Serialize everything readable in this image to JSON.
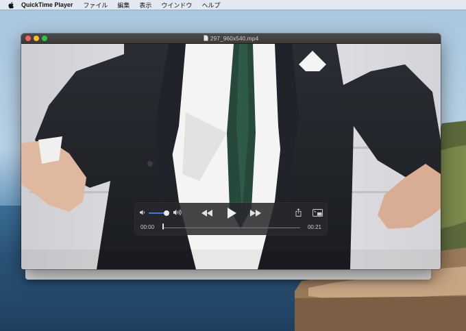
{
  "menubar": {
    "app_name": "QuickTime Player",
    "items": [
      "ファイル",
      "編集",
      "表示",
      "ウインドウ",
      "ヘルプ"
    ]
  },
  "window": {
    "title": "297_960x540.mp4"
  },
  "player": {
    "current_time": "00:00",
    "total_time": "00:21",
    "volume_level": 0.85,
    "progress": 0.0
  },
  "colors": {
    "accent": "#2f7cf6",
    "close": "#ff5f57",
    "minimize": "#febc2e",
    "maximize": "#28c840"
  },
  "icons": [
    "apple-icon",
    "document-icon",
    "volume-low-icon",
    "volume-high-icon",
    "rewind-icon",
    "play-icon",
    "fast-forward-icon",
    "share-icon",
    "picture-in-picture-icon"
  ]
}
